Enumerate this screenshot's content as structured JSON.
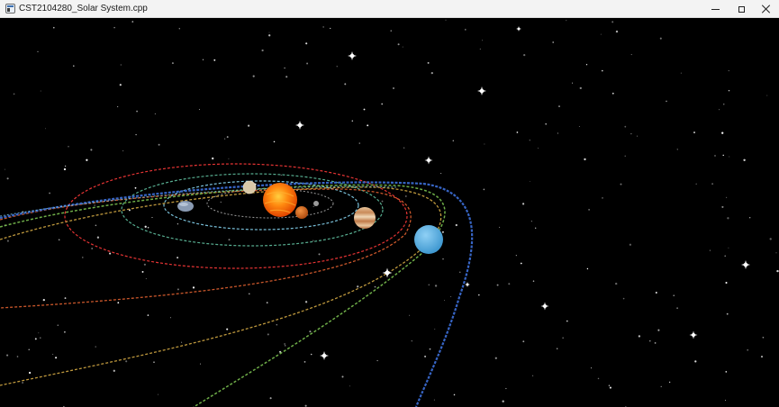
{
  "window": {
    "title": "CST2104280_Solar System.cpp"
  },
  "icons": {
    "app": "app-window-icon",
    "minimize": "minimize-icon",
    "maximize": "maximize-icon",
    "close": "close-icon"
  },
  "scene": {
    "background_color": "#000000",
    "sun_color": "#ff6a00",
    "planets": [
      {
        "name": "mercury",
        "color": "#9a9a9a"
      },
      {
        "name": "venus",
        "color": "#d9c9a8"
      },
      {
        "name": "earth",
        "color": "#8a9bb3"
      },
      {
        "name": "mars",
        "color": "#d2691e"
      },
      {
        "name": "jupiter",
        "color": "#d9a87a"
      },
      {
        "name": "uranus",
        "color": "#5fb4e8"
      }
    ],
    "orbit_colors": [
      "#7ec8e3",
      "#a8a8a8",
      "#ff4040",
      "#c8c84a",
      "#c8a040",
      "#e06030",
      "#d8b060",
      "#60b040",
      "#3060c0"
    ]
  }
}
